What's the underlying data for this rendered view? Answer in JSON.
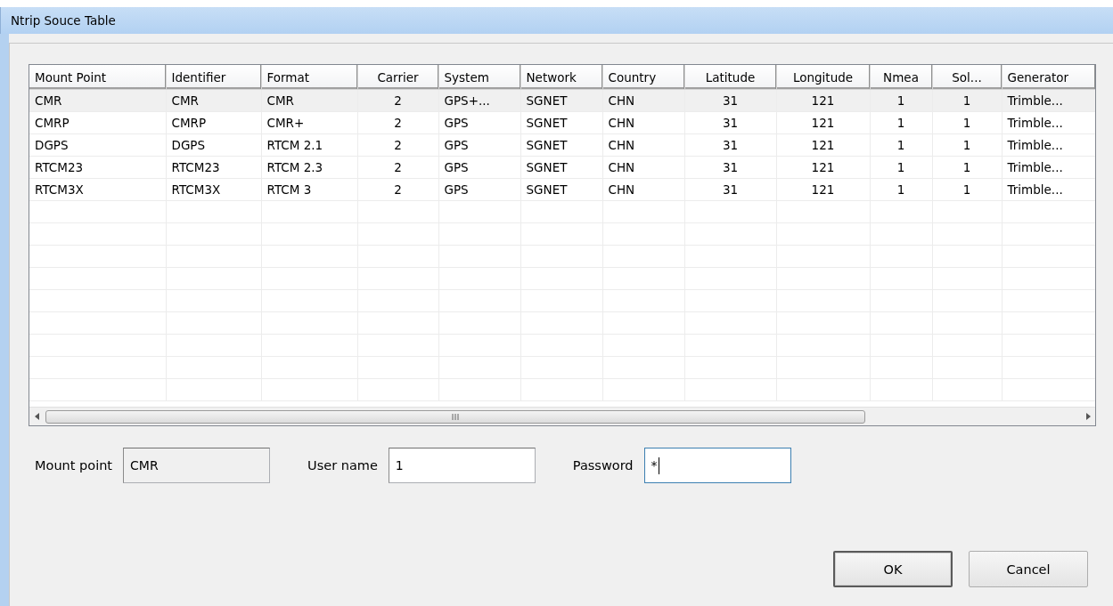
{
  "window": {
    "title": "Ntrip Souce Table"
  },
  "table": {
    "columns": [
      "Mount Point",
      "Identifier",
      "Format",
      "Carrier",
      "System",
      "Network",
      "Country",
      "Latitude",
      "Longitude",
      "Nmea",
      "Sol...",
      "Generator"
    ],
    "rows": [
      {
        "selected": true,
        "cells": [
          "CMR",
          "CMR",
          "CMR",
          "2",
          "GPS+...",
          "SGNET",
          "CHN",
          "31",
          "121",
          "1",
          "1",
          "Trimble..."
        ]
      },
      {
        "selected": false,
        "cells": [
          "CMRP",
          "CMRP",
          "CMR+",
          "2",
          "GPS",
          "SGNET",
          "CHN",
          "31",
          "121",
          "1",
          "1",
          "Trimble..."
        ]
      },
      {
        "selected": false,
        "cells": [
          "DGPS",
          "DGPS",
          "RTCM 2.1",
          "2",
          "GPS",
          "SGNET",
          "CHN",
          "31",
          "121",
          "1",
          "1",
          "Trimble..."
        ]
      },
      {
        "selected": false,
        "cells": [
          "RTCM23",
          "RTCM23",
          "RTCM 2.3",
          "2",
          "GPS",
          "SGNET",
          "CHN",
          "31",
          "121",
          "1",
          "1",
          "Trimble..."
        ]
      },
      {
        "selected": false,
        "cells": [
          "RTCM3X",
          "RTCM3X",
          "RTCM 3",
          "2",
          "GPS",
          "SGNET",
          "CHN",
          "31",
          "121",
          "1",
          "1",
          "Trimble..."
        ]
      }
    ]
  },
  "fields": [
    {
      "label": "Mount point",
      "value": "CMR",
      "disabled": true,
      "focused": false
    },
    {
      "label": "User name",
      "value": "1",
      "disabled": false,
      "focused": false
    },
    {
      "label": "Password",
      "value": "*",
      "disabled": false,
      "focused": true
    }
  ],
  "buttons": [
    {
      "label": "OK",
      "default": true
    },
    {
      "label": "Cancel",
      "default": false
    }
  ]
}
